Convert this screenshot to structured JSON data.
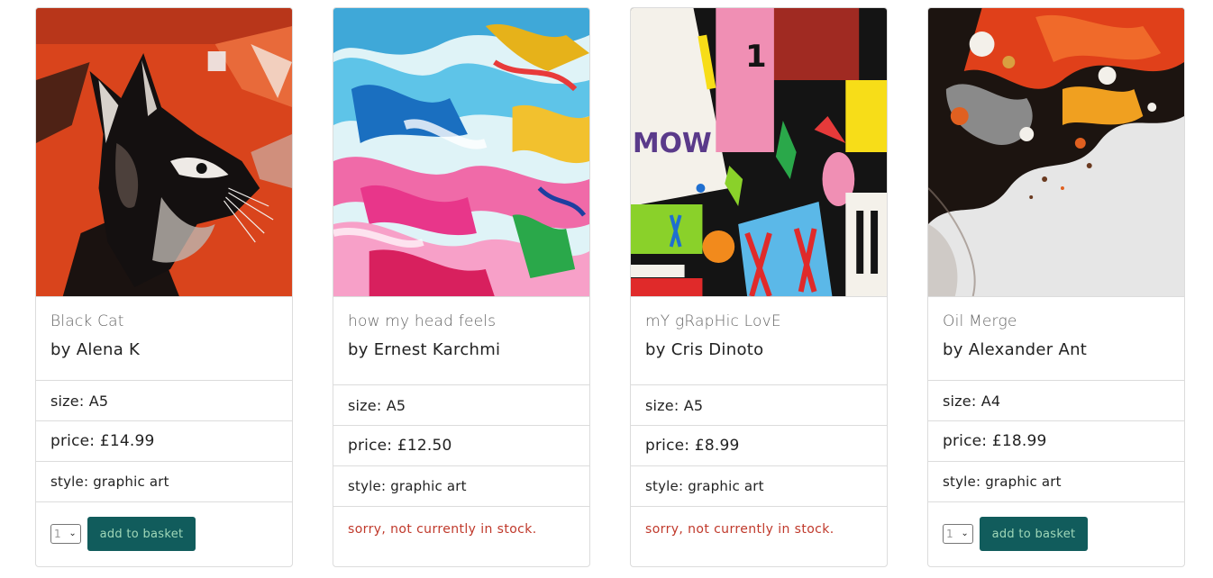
{
  "products": [
    {
      "title": "Black Cat",
      "artist": "by Alena K",
      "size": "size: A5",
      "price": "price: £14.99",
      "style": "style: graphic art",
      "in_stock": true,
      "qty": "1",
      "add_label": "add to basket",
      "art": "stencil-cat-graffiti"
    },
    {
      "title": "how my head feels",
      "artist": "by Ernest Karchmi",
      "size": "size: A5",
      "price": "price: £12.50",
      "style": "style: graphic art",
      "in_stock": false,
      "stock_msg": "sorry, not currently in stock.",
      "art": "marbled-colour-swirl"
    },
    {
      "title": "mY gRapHic LovE",
      "artist": "by Cris Dinoto",
      "size": "size: A5",
      "price": "price: £8.99",
      "style": "style: graphic art",
      "in_stock": false,
      "stock_msg": "sorry, not currently in stock.",
      "art": "geometric-wall-mural"
    },
    {
      "title": "Oil Merge",
      "artist": "by Alexander Ant",
      "size": "size: A4",
      "price": "price: £18.99",
      "style": "style: graphic art",
      "in_stock": true,
      "qty": "1",
      "add_label": "add to basket",
      "art": "acrylic-pour-cells"
    }
  ],
  "colors": {
    "button_bg": "#115c5c",
    "button_text": "#9fd7b8",
    "out_of_stock": "#c0392b",
    "border": "#dcdcdc"
  }
}
